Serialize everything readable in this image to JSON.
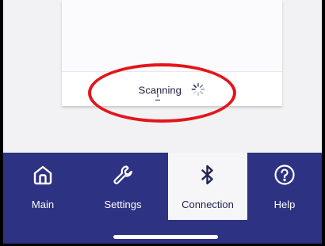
{
  "status": {
    "scanning_label": "Scanning"
  },
  "tabs": [
    {
      "id": "main",
      "label": "Main",
      "icon": "home-icon",
      "active": false
    },
    {
      "id": "settings",
      "label": "Settings",
      "icon": "wrench-icon",
      "active": false
    },
    {
      "id": "connection",
      "label": "Connection",
      "icon": "bluetooth-icon",
      "active": true
    },
    {
      "id": "help",
      "label": "Help",
      "icon": "help-icon",
      "active": false
    }
  ],
  "colors": {
    "tabbar": "#2e3282",
    "active_tab_bg": "#f6f6f8",
    "annotation": "#e2161b"
  }
}
